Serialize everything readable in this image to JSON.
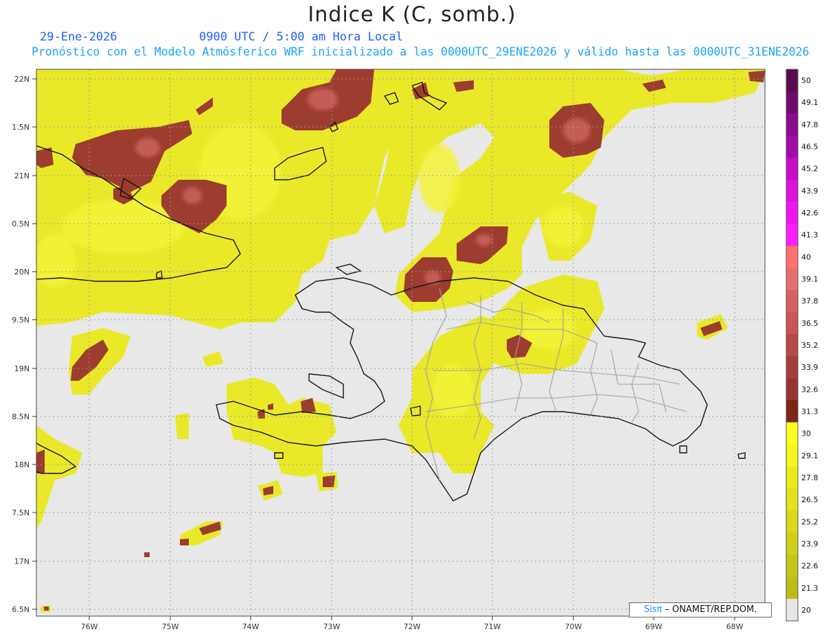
{
  "title": "Indice K (C, somb.)",
  "date": "29-Ene-2026",
  "time": "0900 UTC / 5:00 am Hora Local",
  "forecast_line": "Pronóstico con el Modelo Atmósferico WRF inicializado a las 0000UTC_29ENE2026 y válido hasta las  0000UTC_31ENE2026",
  "credit": {
    "brand": "Sisπ",
    "text": " – ONAMET/REP.DOM."
  },
  "lat_labels": [
    "22N",
    "1.5N",
    "21N",
    "0.5N",
    "20N",
    "9.5N",
    "19N",
    "8.5N",
    "18N",
    "7.5N",
    "17N",
    "6.5N"
  ],
  "lon_labels": [
    "76W",
    "75W",
    "74W",
    "73W",
    "72W",
    "71W",
    "70W",
    "69W",
    "68W"
  ],
  "colorbar": {
    "levels": [
      "50",
      "49.1",
      "47.8",
      "46.5",
      "45.2",
      "43.9",
      "42.6",
      "41.3",
      "40",
      "39.1",
      "37.8",
      "36.5",
      "35.2",
      "33.9",
      "32.6",
      "31.3",
      "30",
      "29.1",
      "27.8",
      "26.5",
      "25.2",
      "23.9",
      "22.6",
      "21.3",
      "20"
    ],
    "colors": [
      "#5a0a4e",
      "#6e0a6e",
      "#8a0b8f",
      "#a10ca8",
      "#c40cc9",
      "#dd10dd",
      "#ef14ef",
      "#ff1eff",
      "#ff7070",
      "#e86f6f",
      "#d96060",
      "#c95555",
      "#b84848",
      "#a63d3d",
      "#963434",
      "#7e2414",
      "#ffff22",
      "#f5f520",
      "#ebeb1e",
      "#e2e21d",
      "#d8d81c",
      "#cfcf1b",
      "#c5c51a",
      "#bcbc19",
      "#e6e6e6"
    ]
  },
  "colors": {
    "background": "#e8e8e8",
    "yellow": "#e9e92a",
    "yellow_light": "#f2f23a",
    "red": "#9c3d2f",
    "red_light": "#c8605a",
    "coast": "#111111",
    "border": "#a0a0a0"
  }
}
